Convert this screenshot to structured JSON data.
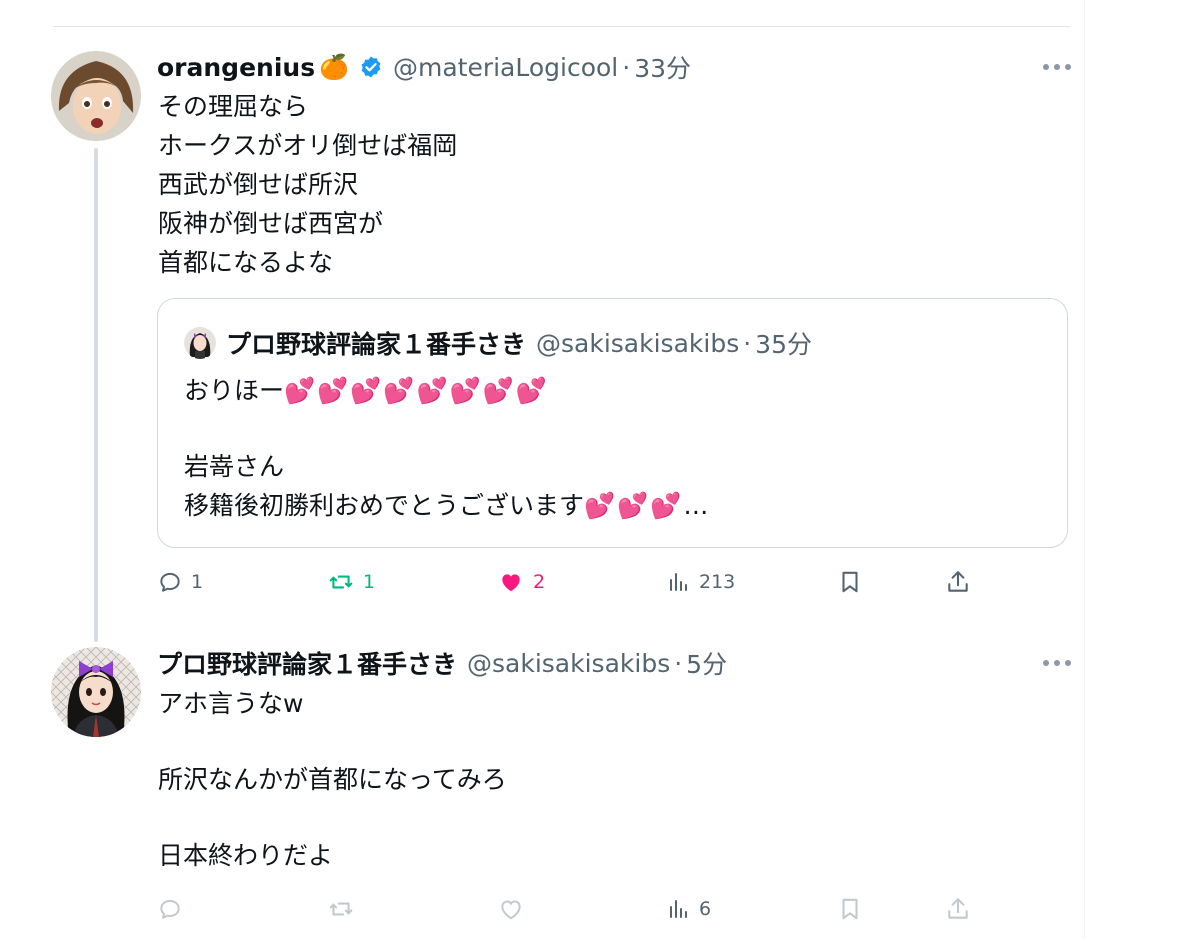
{
  "tweet1": {
    "name": "orangenius",
    "name_emoji": "🍊",
    "handle": "@materiaLogicool",
    "dot": "·",
    "time": "33分",
    "lines": [
      "その理屈なら",
      "ホークスがオリ倒せば福岡",
      "西武が倒せば所沢",
      "阪神が倒せば西宮が",
      "首都になるよな"
    ],
    "quote": {
      "name": "プロ野球評論家１番手さき",
      "handle": "@sakisakisakibs",
      "dot": "·",
      "time": "35分",
      "line1": "おりほー",
      "line1_hearts": "💕💕💕💕💕💕💕💕",
      "line2": "岩嵜さん",
      "line3": "移籍後初勝利おめでとうございます",
      "line3_hearts": "💕💕💕",
      "ellipsis": "…"
    },
    "actions": {
      "replies": "1",
      "reposts": "1",
      "likes": "2",
      "views": "213"
    }
  },
  "tweet2": {
    "name": "プロ野球評論家１番手さき",
    "handle": "@sakisakisakibs",
    "dot": "·",
    "time": "5分",
    "line1": "アホ言うなw",
    "line2": "所沢なんかが首都になってみろ",
    "line3": "日本終わりだよ",
    "actions": {
      "views": "6"
    }
  },
  "colors": {
    "accent": "#1d9bf0",
    "like": "#f91880",
    "repost": "#00ba7c",
    "muted": "#536471"
  }
}
